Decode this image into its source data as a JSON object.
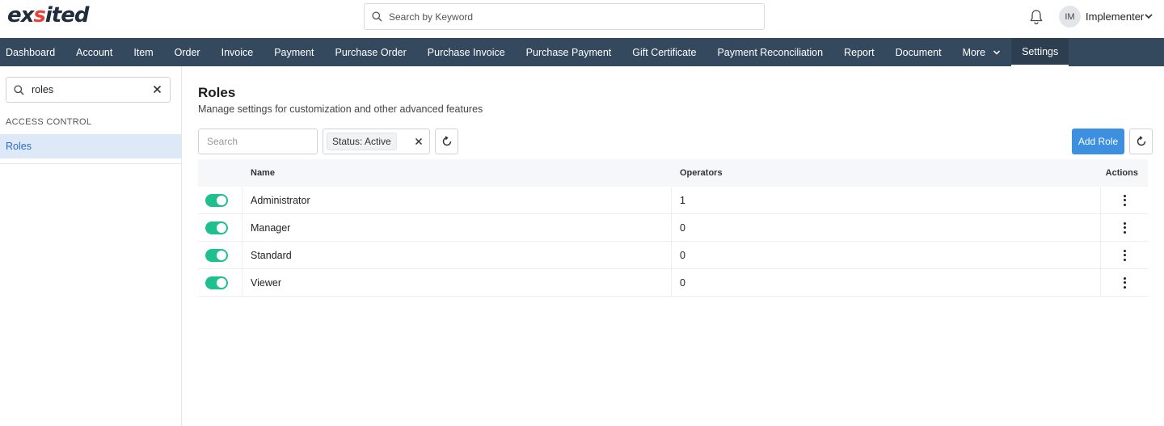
{
  "app": {
    "logo_prefix": "ex",
    "logo_accent": "s",
    "logo_suffix": "ited",
    "global_search_placeholder": "Search by Keyword",
    "user_initials": "IM",
    "user_name": "Implementer"
  },
  "nav": {
    "items": [
      "Dashboard",
      "Account",
      "Item",
      "Order",
      "Invoice",
      "Payment",
      "Purchase Order",
      "Purchase Invoice",
      "Purchase Payment",
      "Gift Certificate",
      "Payment Reconciliation",
      "Report",
      "Document"
    ],
    "more_label": "More",
    "active_label": "Settings"
  },
  "sidebar": {
    "search_value": "roles",
    "section_label": "ACCESS CONTROL",
    "active_item": "Roles"
  },
  "page": {
    "title": "Roles",
    "subtitle": "Manage settings for customization and other advanced features"
  },
  "filters": {
    "search_placeholder": "Search",
    "status_chip": "Status: Active",
    "add_button": "Add Role"
  },
  "table": {
    "columns": {
      "name": "Name",
      "operators": "Operators",
      "actions": "Actions"
    },
    "rows": [
      {
        "enabled": true,
        "name": "Administrator",
        "operators": "1"
      },
      {
        "enabled": true,
        "name": "Manager",
        "operators": "0"
      },
      {
        "enabled": true,
        "name": "Standard",
        "operators": "0"
      },
      {
        "enabled": true,
        "name": "Viewer",
        "operators": "0"
      }
    ]
  },
  "colors": {
    "nav_bg": "#34495e",
    "accent_blue": "#3d8fe0",
    "toggle_on": "#1fbf8f",
    "logo_red": "#e8413a"
  }
}
